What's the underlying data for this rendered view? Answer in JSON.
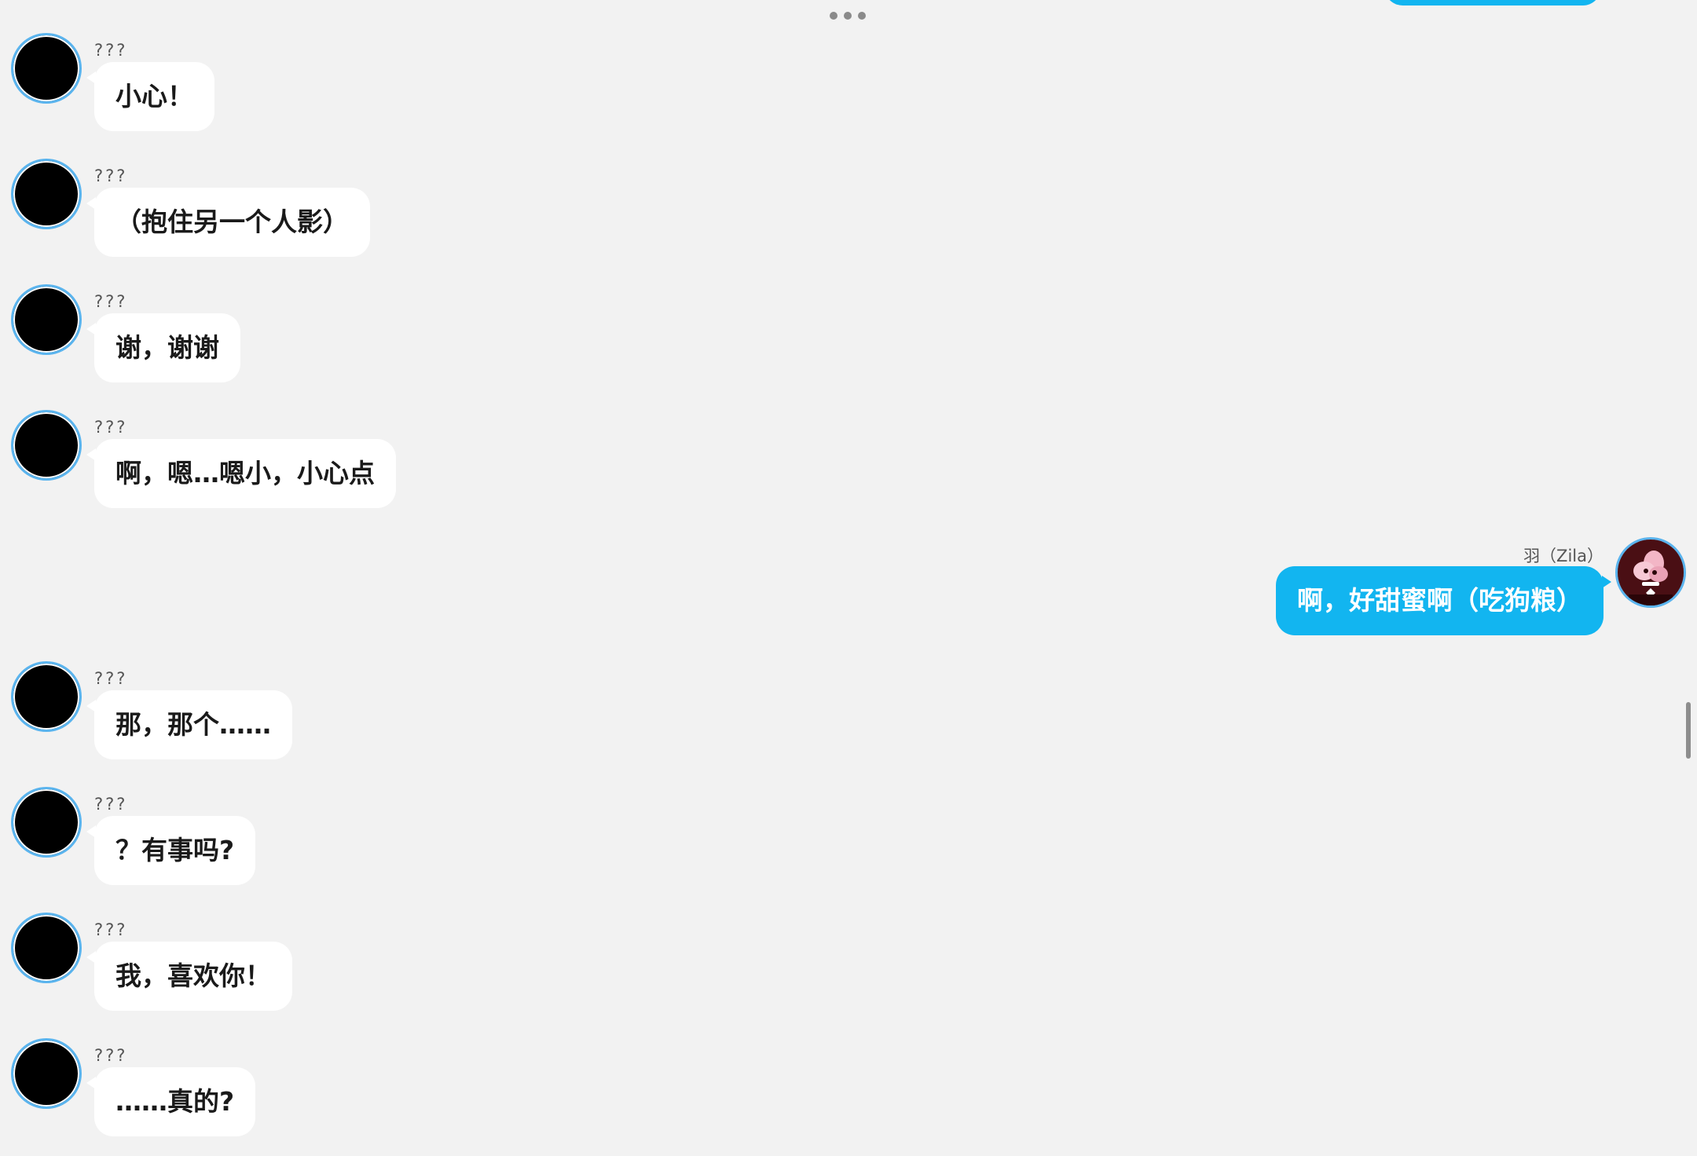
{
  "menu": {
    "icon": "more-horizontal-icon"
  },
  "colors": {
    "background": "#f2f2f2",
    "incoming_bubble": "#ffffff",
    "outgoing_bubble": "#12b5f0",
    "avatar_ring": "#5ab4ee"
  },
  "messages": [
    {
      "sender": "???",
      "text": "小心！"
    },
    {
      "sender": "???",
      "text": "（抱住另一个人影）"
    },
    {
      "sender": "???",
      "text": "谢，谢谢"
    },
    {
      "sender": "???",
      "text": "啊，嗯…嗯小，小心点"
    },
    {
      "sender": "羽（Zila）",
      "text": "啊，好甜蜜啊（吃狗粮）"
    },
    {
      "sender": "???",
      "text": "那，那个……"
    },
    {
      "sender": "???",
      "text": "？有事吗?"
    },
    {
      "sender": "???",
      "text": "我，喜欢你！"
    },
    {
      "sender": "???",
      "text": "……真的?"
    }
  ]
}
